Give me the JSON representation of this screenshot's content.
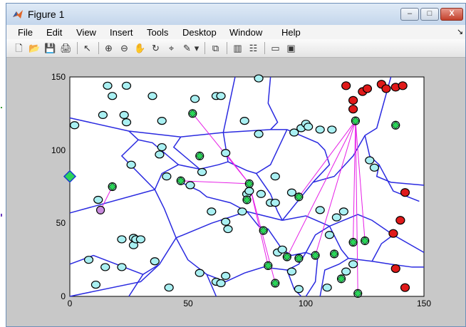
{
  "window": {
    "title": "Figure 1",
    "min_label": "–",
    "max_label": "□",
    "close_label": "X"
  },
  "menu": [
    "File",
    "Edit",
    "View",
    "Insert",
    "Tools",
    "Desktop",
    "Window",
    "Help"
  ],
  "menu_overflow": "↘",
  "toolbar": [
    "new-figure-icon",
    "open-file-icon",
    "save-icon",
    "print-icon",
    "pointer-icon",
    "zoom-in-icon",
    "zoom-out-icon",
    "pan-hand-icon",
    "rotate-3d-icon",
    "data-cursor-icon",
    "brush-icon",
    "brush-dropdown-icon",
    "link-plot-icon",
    "colorbar-icon",
    "legend-icon",
    "hide-plot-tools-icon",
    "show-plot-tools-icon"
  ],
  "toolbar_glyphs": [
    "🗋",
    "📂",
    "💾",
    "🖨",
    "↖",
    "⊕",
    "⊖",
    "✋",
    "↻",
    "⌖",
    "✎",
    "▾",
    "⧉",
    "▥",
    "☷",
    "▭",
    "▣"
  ],
  "colors": {
    "cyan": "#a9f0f2",
    "red": "#e01a1a",
    "green": "#2bd45a",
    "edge": "#2a2ae0",
    "link": "#e61ee6",
    "purple_marker": "#c98bde"
  },
  "chart_data": {
    "type": "scatter",
    "xlim": [
      0,
      150
    ],
    "ylim": [
      0,
      150
    ],
    "xticks": [
      "0",
      "50",
      "100",
      "150"
    ],
    "yticks": [
      "0",
      "50",
      "100",
      "150"
    ],
    "cyan_points": [
      [
        2,
        117
      ],
      [
        8,
        25
      ],
      [
        11,
        8
      ],
      [
        12,
        66
      ],
      [
        14,
        124
      ],
      [
        15,
        20
      ],
      [
        16,
        144
      ],
      [
        18,
        137
      ],
      [
        22,
        20
      ],
      [
        22,
        39
      ],
      [
        23,
        124
      ],
      [
        24,
        144
      ],
      [
        24,
        119
      ],
      [
        26,
        90
      ],
      [
        27,
        40
      ],
      [
        27,
        35
      ],
      [
        28,
        39
      ],
      [
        30,
        39
      ],
      [
        35,
        137
      ],
      [
        36,
        24
      ],
      [
        38,
        97
      ],
      [
        39,
        102
      ],
      [
        39,
        120
      ],
      [
        41,
        82
      ],
      [
        42,
        6
      ],
      [
        51,
        76
      ],
      [
        53,
        135
      ],
      [
        55,
        16
      ],
      [
        56,
        85
      ],
      [
        60,
        58
      ],
      [
        62,
        10
      ],
      [
        62,
        137
      ],
      [
        64,
        9
      ],
      [
        64,
        137
      ],
      [
        66,
        98
      ],
      [
        66,
        51
      ],
      [
        66,
        14
      ],
      [
        67,
        46
      ],
      [
        73,
        58
      ],
      [
        74,
        120
      ],
      [
        75,
        70
      ],
      [
        76,
        72
      ],
      [
        80,
        149
      ],
      [
        80,
        111
      ],
      [
        81,
        70
      ],
      [
        85,
        64
      ],
      [
        87,
        82
      ],
      [
        87,
        64
      ],
      [
        88,
        30
      ],
      [
        90,
        32
      ],
      [
        94,
        17
      ],
      [
        94,
        71
      ],
      [
        95,
        112
      ],
      [
        97,
        5
      ],
      [
        98,
        115
      ],
      [
        100,
        118
      ],
      [
        101,
        116
      ],
      [
        106,
        114
      ],
      [
        106,
        59
      ],
      [
        109,
        6
      ],
      [
        110,
        42
      ],
      [
        111,
        114
      ],
      [
        113,
        54
      ],
      [
        116,
        58
      ],
      [
        117,
        17
      ],
      [
        120,
        22
      ],
      [
        127,
        93
      ],
      [
        129,
        88
      ]
    ],
    "green_points": [
      [
        52,
        125
      ],
      [
        55,
        96
      ],
      [
        47,
        79
      ],
      [
        76,
        77
      ],
      [
        75,
        66
      ],
      [
        82,
        45
      ],
      [
        84,
        21
      ],
      [
        87,
        9
      ],
      [
        92,
        27
      ],
      [
        97,
        26
      ],
      [
        104,
        28
      ],
      [
        97,
        68
      ],
      [
        112,
        29
      ],
      [
        115,
        12
      ],
      [
        121,
        120
      ],
      [
        120,
        37
      ],
      [
        125,
        38
      ],
      [
        122,
        2
      ],
      [
        138,
        117
      ],
      [
        18,
        75
      ]
    ],
    "red_points": [
      [
        117,
        144
      ],
      [
        120,
        134
      ],
      [
        120,
        128
      ],
      [
        124,
        140
      ],
      [
        126,
        142
      ],
      [
        132,
        145
      ],
      [
        134,
        142
      ],
      [
        138,
        143
      ],
      [
        141,
        144
      ],
      [
        142,
        71
      ],
      [
        140,
        52
      ],
      [
        137,
        43
      ],
      [
        142,
        6
      ],
      [
        138,
        19
      ]
    ],
    "special_points": [
      {
        "x": 13,
        "y": 59,
        "kind": "purple-circle"
      },
      {
        "x": 0,
        "y": 82,
        "kind": "green-diamond"
      }
    ]
  }
}
